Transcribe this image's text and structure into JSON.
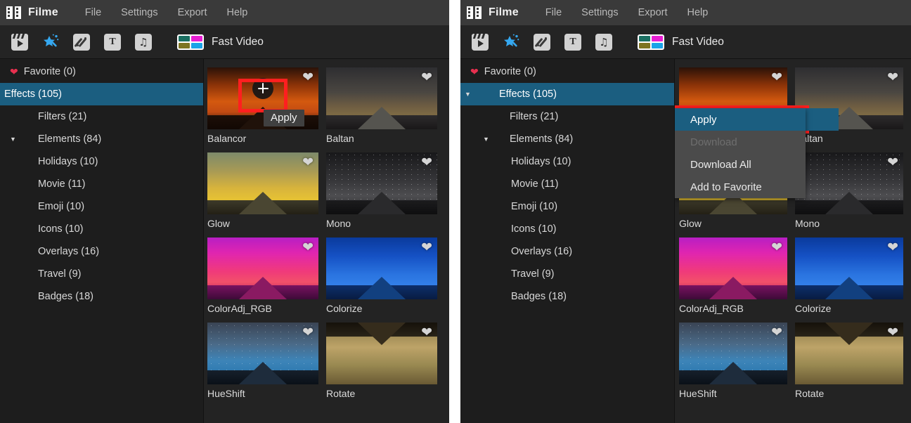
{
  "app": {
    "brand": "Filme",
    "logo_icon": "film-strip-icon",
    "menus": [
      "File",
      "Settings",
      "Export",
      "Help"
    ]
  },
  "toolbar": {
    "items": [
      {
        "icon": "media-clapperboard-icon",
        "active": false
      },
      {
        "icon": "effects-magic-wand-icon",
        "active": true
      },
      {
        "icon": "transitions-icon",
        "active": false
      },
      {
        "icon": "text-icon",
        "active": false
      },
      {
        "icon": "audio-music-note-icon",
        "active": false
      }
    ],
    "fast_video_label": "Fast Video",
    "fast_video_icon": "fast-video-grid-icon",
    "fast_video_colors": [
      "#1b6f62",
      "#e81ed2",
      "#7d7422",
      "#1ba3e8"
    ]
  },
  "sidebar": {
    "favorite": {
      "label": "Favorite (0)",
      "icon": "heart-icon"
    },
    "items": [
      {
        "label": "Effects (105)",
        "level": 0,
        "selected": true,
        "caret": "▼"
      },
      {
        "label": "Filters (21)",
        "level": 1,
        "selected": false,
        "caret": ""
      },
      {
        "label": "Elements (84)",
        "level": 1,
        "selected": false,
        "caret": "▼"
      },
      {
        "label": "Holidays (10)",
        "level": 2,
        "selected": false,
        "caret": ""
      },
      {
        "label": "Movie (11)",
        "level": 2,
        "selected": false,
        "caret": ""
      },
      {
        "label": "Emoji (10)",
        "level": 2,
        "selected": false,
        "caret": ""
      },
      {
        "label": "Icons (10)",
        "level": 2,
        "selected": false,
        "caret": ""
      },
      {
        "label": "Overlays (16)",
        "level": 2,
        "selected": false,
        "caret": ""
      },
      {
        "label": "Travel (9)",
        "level": 2,
        "selected": false,
        "caret": ""
      },
      {
        "label": "Badges (18)",
        "level": 2,
        "selected": false,
        "caret": ""
      }
    ]
  },
  "effects_grid": [
    {
      "name": "Balancor",
      "selected": true,
      "favorite_icon": "heart-icon"
    },
    {
      "name": "Baltan",
      "selected": false,
      "favorite_icon": "heart-icon"
    },
    {
      "name": "Glow",
      "selected": false,
      "favorite_icon": "heart-icon"
    },
    {
      "name": "Mono",
      "selected": false,
      "favorite_icon": "heart-icon"
    },
    {
      "name": "ColorAdj_RGB",
      "selected": false,
      "favorite_icon": "heart-icon"
    },
    {
      "name": "Colorize",
      "selected": false,
      "favorite_icon": "heart-icon"
    },
    {
      "name": "HueShift",
      "selected": false,
      "favorite_icon": "heart-icon"
    },
    {
      "name": "Rotate",
      "selected": false,
      "favorite_icon": "heart-icon"
    }
  ],
  "left_panel": {
    "apply_button_icon": "plus-circle-icon",
    "apply_tooltip": "Apply"
  },
  "right_panel": {
    "context_menu": [
      {
        "label": "Apply",
        "state": "highlighted"
      },
      {
        "label": "Download",
        "state": "disabled"
      },
      {
        "label": "Download All",
        "state": "normal"
      },
      {
        "label": "Add to Favorite",
        "state": "normal"
      }
    ]
  },
  "colors": {
    "accent_blue": "#1b5e80",
    "annotation_red": "#ff1f1f",
    "titlebar": "#3a3a3a",
    "toolbar": "#242424",
    "sidebar": "#1d1d1d",
    "content": "#232323",
    "heart_red": "#e8304f",
    "menu_bg": "#4b4b4b"
  }
}
